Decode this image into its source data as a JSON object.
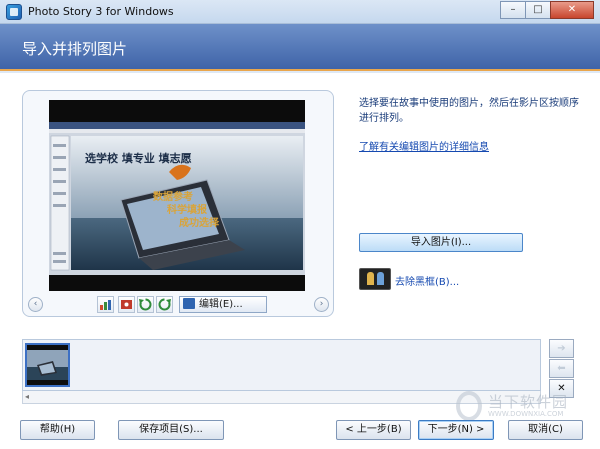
{
  "window": {
    "title": "Photo Story 3 for Windows",
    "controls": {
      "minimize": "–",
      "maximize": "□",
      "close": "✕"
    }
  },
  "header": {
    "title": "导入并排列图片"
  },
  "preview": {
    "screenshot_slogan": "选学校  填专业  填志愿",
    "screenshot_lines": [
      "数据参考",
      "科学填报",
      "成功选择"
    ],
    "edit_label": "编辑(E)...",
    "prev_arrow": "‹",
    "next_arrow": "›"
  },
  "instructions": {
    "text": "选择要在故事中使用的图片，然后在影片区按顺序进行排列。",
    "link": "了解有关编辑图片的详细信息",
    "import_button": "导入图片(I)...",
    "remove_black_label": "去除黑框(B)..."
  },
  "filmstrip": {
    "scroll_left": "◂",
    "move_right": "➔",
    "move_left": "⬅",
    "delete": "✕"
  },
  "footer": {
    "help": "帮助(H)",
    "save": "保存项目(S)...",
    "back": "< 上一步(B)",
    "next": "下一步(N) >",
    "cancel": "取消(C)"
  },
  "watermark": {
    "text": "当下软件园",
    "sub": "WWW.DOWNXIA.COM"
  },
  "colors": {
    "header": "#4f72b4",
    "accent_line": "#e9a64d",
    "link": "#1549b0"
  }
}
